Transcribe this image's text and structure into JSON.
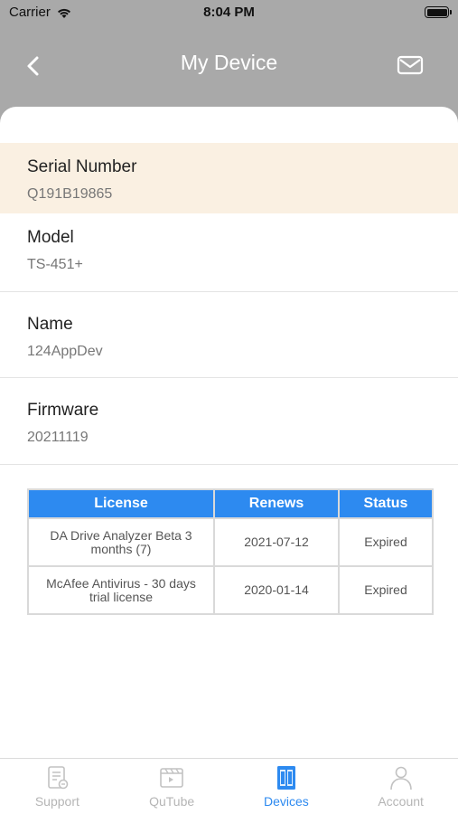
{
  "status_bar": {
    "carrier": "Carrier",
    "time": "8:04 PM"
  },
  "nav": {
    "title": "My Device",
    "back_icon": "chevron-left-icon",
    "mail_icon": "mail-icon"
  },
  "fields": {
    "serial": {
      "label": "Serial Number",
      "value": "Q191B19865"
    },
    "model": {
      "label": "Model",
      "value": "TS-451+"
    },
    "name": {
      "label": "Name",
      "value": "124AppDev"
    },
    "firmware": {
      "label": "Firmware",
      "value": "20211119"
    }
  },
  "license_table": {
    "headers": [
      "License",
      "Renews",
      "Status"
    ],
    "rows": [
      [
        "DA Drive Analyzer Beta 3 months (7)",
        "2021-07-12",
        "Expired"
      ],
      [
        "McAfee Antivirus - 30 days trial license",
        "2020-01-14",
        "Expired"
      ]
    ]
  },
  "tabs": [
    {
      "label": "Support",
      "icon": "support-icon",
      "active": false
    },
    {
      "label": "QuTube",
      "icon": "qutube-icon",
      "active": false
    },
    {
      "label": "Devices",
      "icon": "devices-icon",
      "active": true
    },
    {
      "label": "Account",
      "icon": "account-icon",
      "active": false
    }
  ],
  "colors": {
    "accent": "#2d8af0",
    "highlight": "#faf0e2",
    "header_bg": "#a9a9a9"
  }
}
